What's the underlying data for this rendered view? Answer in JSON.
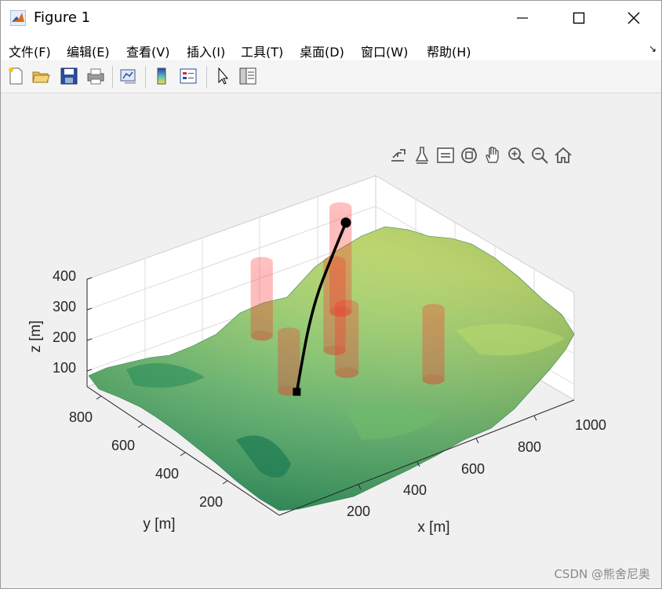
{
  "window": {
    "title": "Figure 1"
  },
  "menu": [
    "文件(F)",
    "编辑(E)",
    "查看(V)",
    "插入(I)",
    "工具(T)",
    "桌面(D)",
    "窗口(W)",
    "帮助(H)"
  ],
  "toolbar_icons": [
    "new-figure-icon",
    "open-file-icon",
    "save-icon",
    "print-icon",
    "link-plot-icon",
    "colorbar-icon",
    "legend-icon",
    "edit-plot-icon",
    "property-inspector-icon"
  ],
  "axes_toolbar_icons": [
    "export-icon",
    "brush-icon",
    "datatip-icon",
    "rotate-3d-icon",
    "pan-icon",
    "zoom-in-icon",
    "zoom-out-icon",
    "restore-view-icon"
  ],
  "watermark": "CSDN @熊舍尼奥",
  "colors": {
    "terrain_low": "#1f8a5a",
    "terrain_high": "#c8e06a",
    "threat": "#ff3030",
    "path": "#000000"
  },
  "chart_data": {
    "type": "surface3d",
    "xlabel": "x [m]",
    "ylabel": "y [m]",
    "zlabel": "z [m]",
    "xticks": [
      "200",
      "400",
      "600",
      "800",
      "1000"
    ],
    "yticks": [
      "200",
      "400",
      "600",
      "800"
    ],
    "zticks": [
      "100",
      "200",
      "300",
      "400"
    ],
    "xlim": [
      0,
      1100
    ],
    "ylim": [
      0,
      900
    ],
    "zlim": [
      50,
      400
    ],
    "grid": true,
    "threats": [
      {
        "x": 850,
        "y": 780,
        "r": 70,
        "h": 400
      },
      {
        "x": 700,
        "y": 620,
        "r": 70,
        "h": 350
      },
      {
        "x": 580,
        "y": 810,
        "r": 70,
        "h": 300
      },
      {
        "x": 650,
        "y": 500,
        "r": 75,
        "h": 280
      },
      {
        "x": 830,
        "y": 320,
        "r": 70,
        "h": 290
      },
      {
        "x": 450,
        "y": 520,
        "r": 70,
        "h": 250
      }
    ],
    "path": [
      {
        "x": 400,
        "y": 420,
        "z": 120
      },
      {
        "x": 470,
        "y": 480,
        "z": 180
      },
      {
        "x": 540,
        "y": 540,
        "z": 230
      },
      {
        "x": 620,
        "y": 600,
        "z": 280
      },
      {
        "x": 700,
        "y": 650,
        "z": 320
      },
      {
        "x": 770,
        "y": 690,
        "z": 360
      },
      {
        "x": 830,
        "y": 730,
        "z": 380
      }
    ]
  }
}
